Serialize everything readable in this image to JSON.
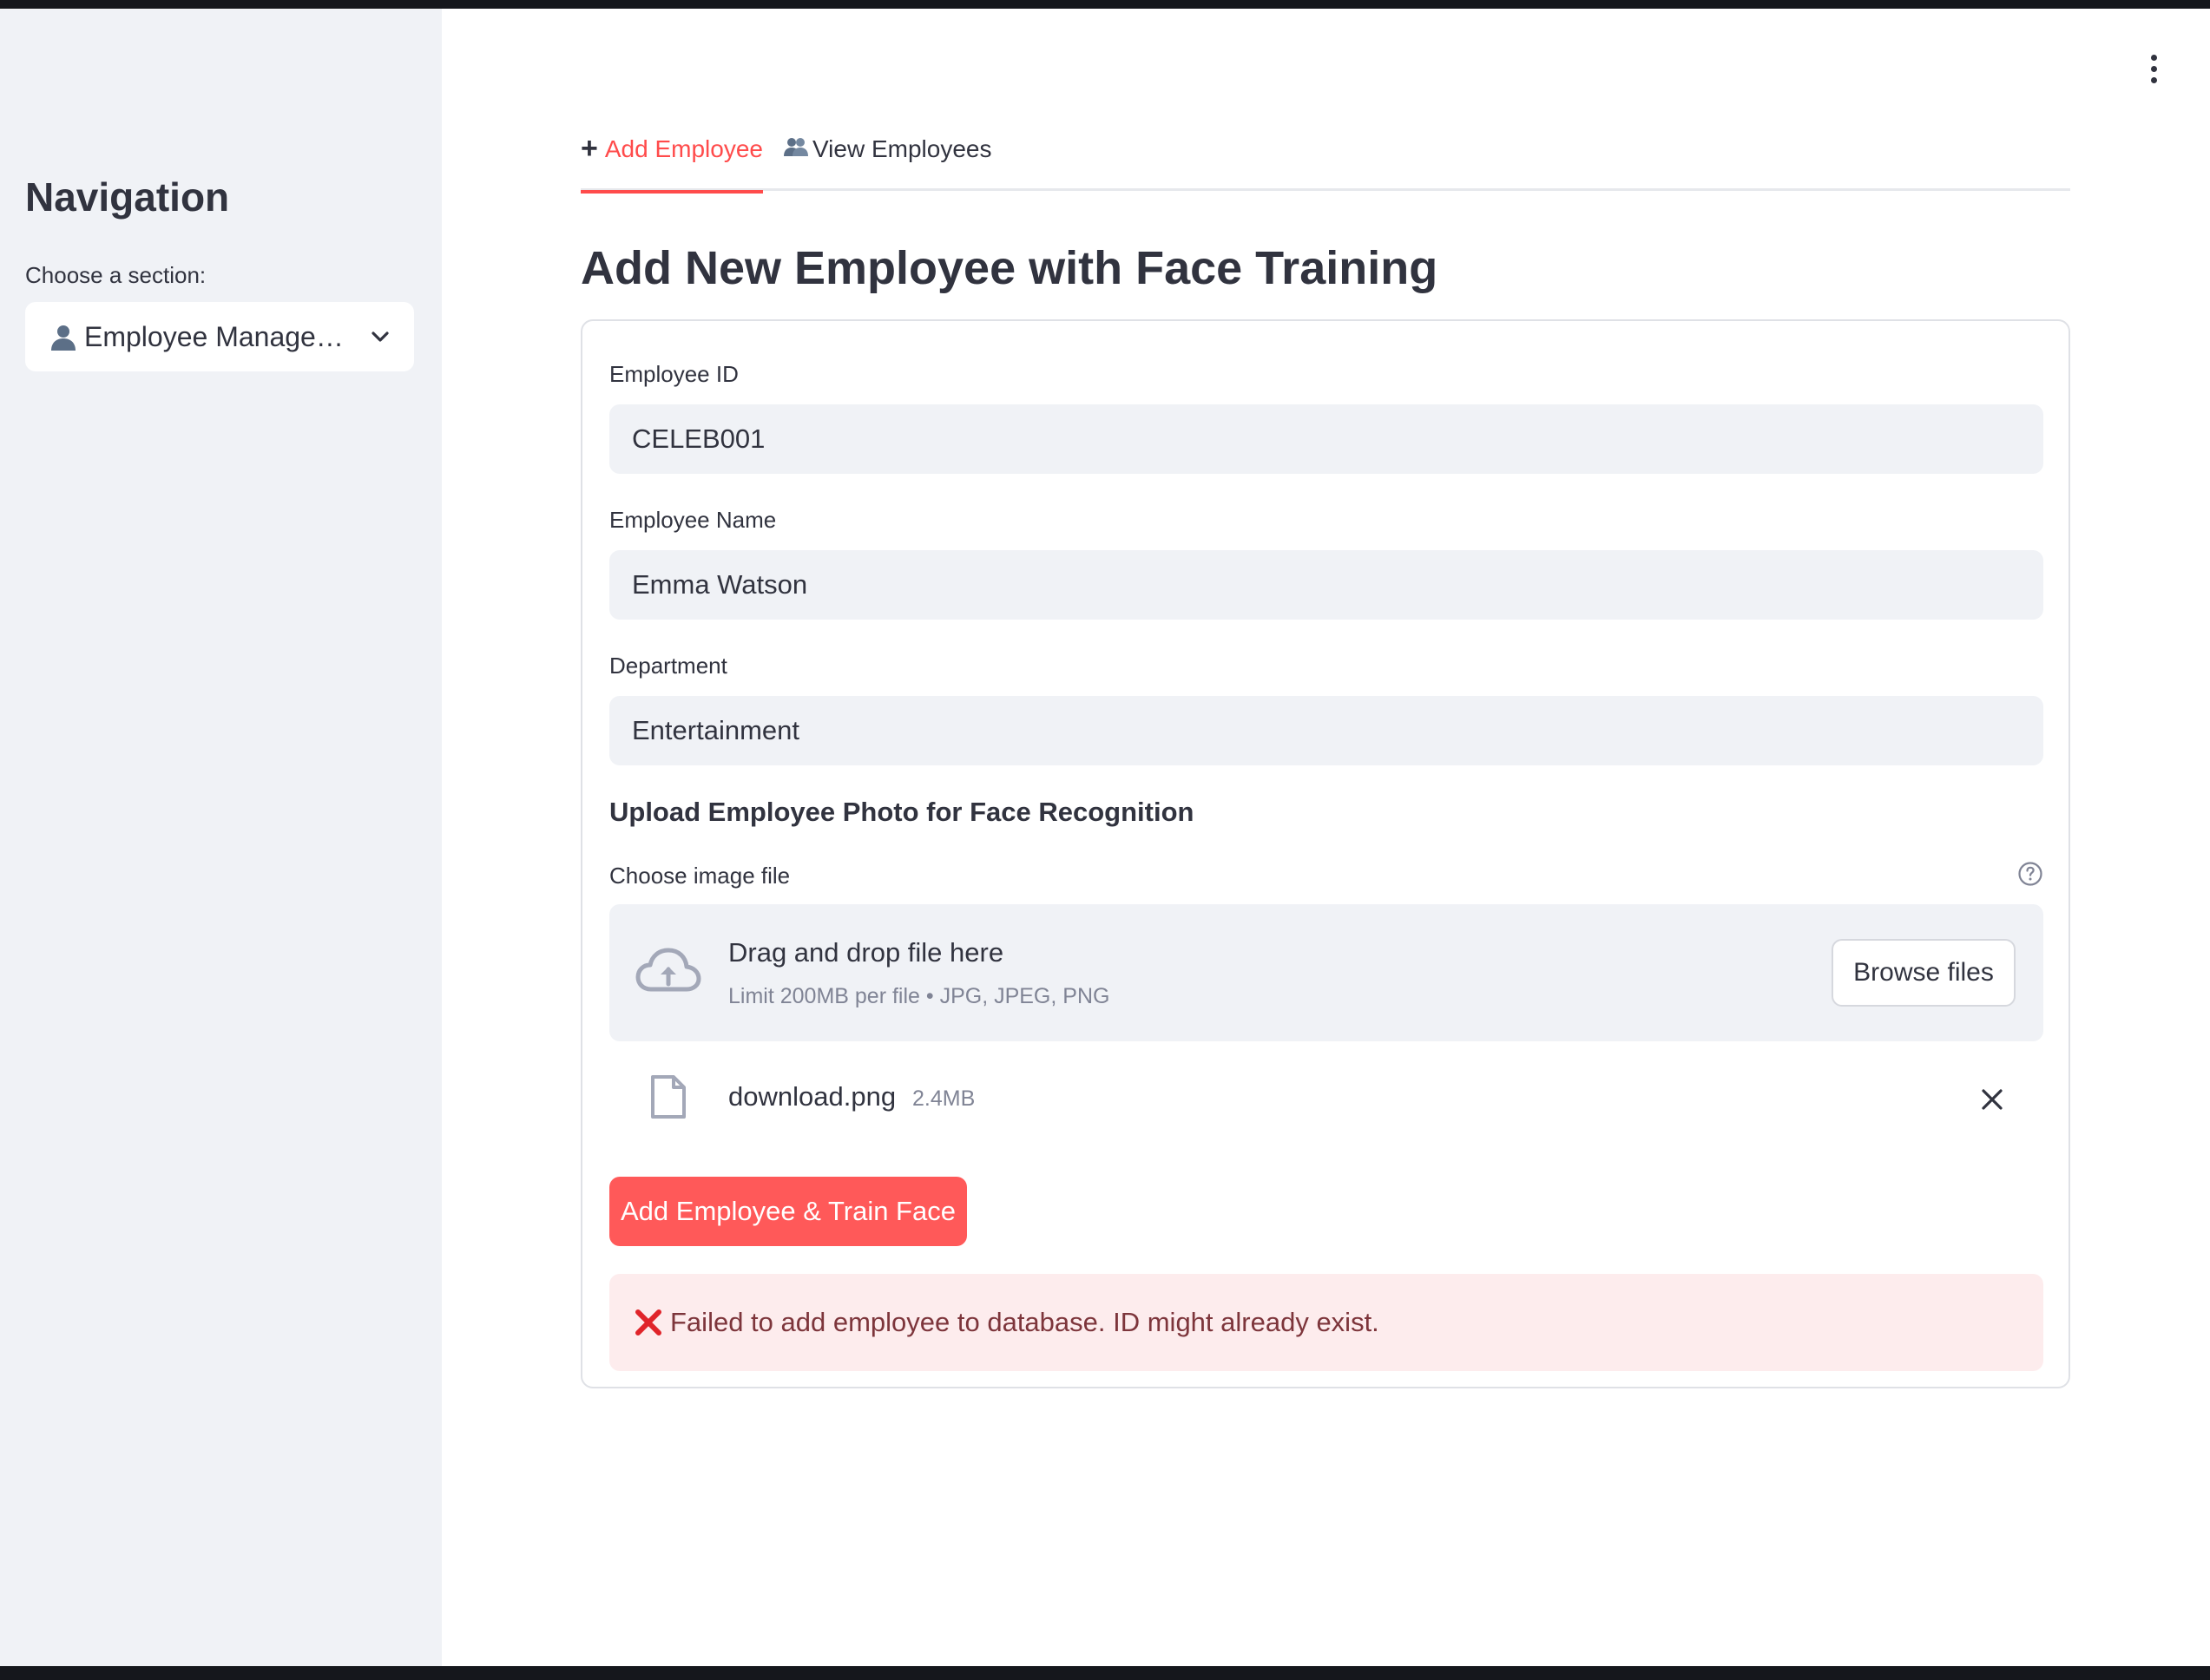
{
  "sidebar": {
    "title": "Navigation",
    "section_label": "Choose a section:",
    "selected_section": "Employee Manage…"
  },
  "tabs": [
    {
      "label": "Add Employee",
      "active": true
    },
    {
      "label": "View Employees",
      "active": false
    }
  ],
  "page": {
    "title": "Add New Employee with Face Training"
  },
  "form": {
    "employee_id": {
      "label": "Employee ID",
      "value": "CELEB001"
    },
    "employee_name": {
      "label": "Employee Name",
      "value": "Emma Watson"
    },
    "department": {
      "label": "Department",
      "value": "Entertainment"
    },
    "upload_heading": "Upload Employee Photo for Face Recognition",
    "file_label": "Choose image file",
    "dropzone": {
      "title": "Drag and drop file here",
      "subtitle": "Limit 200MB per file • JPG, JPEG, PNG",
      "browse_label": "Browse files"
    },
    "uploaded_file": {
      "name": "download.png",
      "size": "2.4MB"
    },
    "submit_label": "Add Employee & Train Face",
    "error_message": "Failed to add employee to database. ID might already exist."
  },
  "colors": {
    "accent": "#ff4b4b",
    "sidebar_bg": "#f0f2f6",
    "error_bg": "#fdeced",
    "error_text": "#7d353b"
  },
  "icons": [
    "person-icon",
    "chevron-down-icon",
    "plus-icon",
    "people-icon",
    "kebab-menu-icon",
    "help-icon",
    "cloud-upload-icon",
    "file-icon",
    "close-icon",
    "error-x-icon"
  ]
}
